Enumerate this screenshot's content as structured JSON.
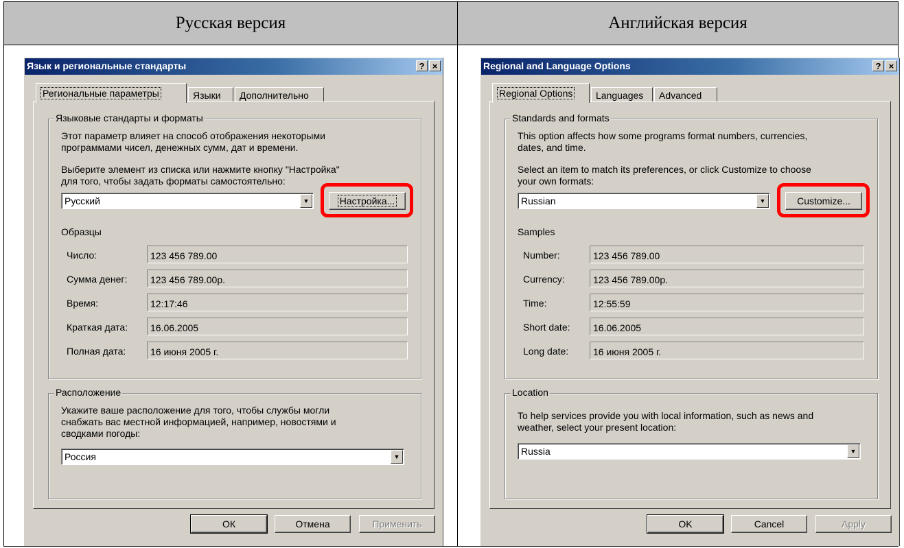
{
  "headers": {
    "left": "Русская версия",
    "right": "Английская версия"
  },
  "ru": {
    "title": "Язык и региональные стандарты",
    "help_btn": "?",
    "close_btn": "×",
    "tabs": [
      "Региональные параметры",
      "Языки",
      "Дополнительно"
    ],
    "group1_title": "Языковые стандарты и форматы",
    "desc_line1": "Этот параметр влияет на способ отображения некоторыми",
    "desc_line2": "программами чисел, денежных сумм, дат и времени.",
    "select_line1": "Выберите элемент из списка или нажмите кнопку \"Настройка\"",
    "select_line2": "для того, чтобы задать форматы самостоятельно:",
    "locale_value": "Русский",
    "customize_label": "Настройка...",
    "samples_title": "Образцы",
    "samples": [
      {
        "label": "Число:",
        "value": "123 456 789.00"
      },
      {
        "label": "Сумма денег:",
        "value": "123 456 789.00р."
      },
      {
        "label": "Время:",
        "value": "12:17:46"
      },
      {
        "label": "Краткая дата:",
        "value": "16.06.2005"
      },
      {
        "label": "Полная дата:",
        "value": "16 июня 2005 г."
      }
    ],
    "location_title": "Расположение",
    "loc_line1": "Укажите ваше расположение для того, чтобы службы могли",
    "loc_line2": "снабжать вас местной информацией, например, новостями и",
    "loc_line3": "сводками погоды:",
    "location_value": "Россия",
    "ok_label": "ОК",
    "cancel_label": "Отмена",
    "apply_label": "Применить"
  },
  "en": {
    "title": "Regional and Language Options",
    "help_btn": "?",
    "close_btn": "×",
    "tabs": [
      "Regional Options",
      "Languages",
      "Advanced"
    ],
    "group1_title": "Standards and formats",
    "desc_line1": "This option affects how some programs format numbers, currencies,",
    "desc_line2": "dates, and time.",
    "select_line1": "Select an item to match its preferences, or click Customize to choose",
    "select_line2": "your own formats:",
    "locale_value": "Russian",
    "customize_label": "Customize...",
    "samples_title": "Samples",
    "samples": [
      {
        "label": "Number:",
        "value": "123 456 789.00"
      },
      {
        "label": "Currency:",
        "value": "123 456 789.00р."
      },
      {
        "label": "Time:",
        "value": "12:55:59"
      },
      {
        "label": "Short date:",
        "value": "16.06.2005"
      },
      {
        "label": "Long date:",
        "value": "16 июня 2005 г."
      }
    ],
    "location_title": "Location",
    "loc_line1": "To help services provide you with local information, such as news and",
    "loc_line2": "weather, select your present location:",
    "location_value": "Russia",
    "ok_label": "OK",
    "cancel_label": "Cancel",
    "apply_label": "Apply"
  }
}
